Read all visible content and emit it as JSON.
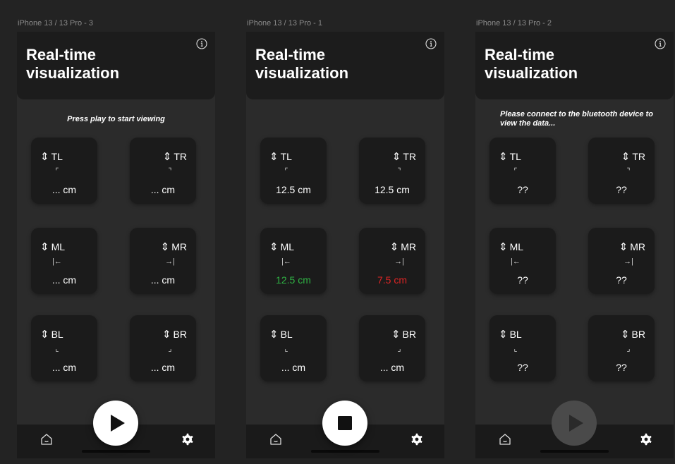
{
  "screens": [
    {
      "frame_label": "iPhone 13 / 13 Pro - 3",
      "title": "Real-time visualization",
      "message": "Press play to start viewing",
      "cards": [
        {
          "label": "TL",
          "glyph": "⌜",
          "value": "... cm"
        },
        {
          "label": "TR",
          "glyph": "⌝",
          "value": "... cm"
        },
        {
          "label": "ML",
          "glyph": "|←",
          "value": "... cm"
        },
        {
          "label": "MR",
          "glyph": "→|",
          "value": "... cm"
        },
        {
          "label": "BL",
          "glyph": "⌞",
          "value": "... cm"
        },
        {
          "label": "BR",
          "glyph": "⌟",
          "value": "... cm"
        }
      ],
      "fab_icon": "play-icon"
    },
    {
      "frame_label": "iPhone 13 / 13 Pro - 1",
      "title": "Real-time visualization",
      "message": "",
      "cards": [
        {
          "label": "TL",
          "glyph": "⌜",
          "value": "12.5 cm"
        },
        {
          "label": "TR",
          "glyph": "⌝",
          "value": "12.5 cm"
        },
        {
          "label": "ML",
          "glyph": "|←",
          "value": "12.5 cm",
          "value_color": "#2fb344"
        },
        {
          "label": "MR",
          "glyph": "→|",
          "value": "7.5 cm",
          "value_color": "#e02424"
        },
        {
          "label": "BL",
          "glyph": "⌞",
          "value": "... cm"
        },
        {
          "label": "BR",
          "glyph": "⌟",
          "value": "... cm"
        }
      ],
      "fab_icon": "stop-icon"
    },
    {
      "frame_label": "iPhone 13 / 13 Pro - 2",
      "title": "Real-time visualization",
      "message": "Please connect to the bluetooth device to view the data...",
      "cards": [
        {
          "label": "TL",
          "glyph": "⌜",
          "value": "??"
        },
        {
          "label": "TR",
          "glyph": "⌝",
          "value": "??"
        },
        {
          "label": "ML",
          "glyph": "|←",
          "value": "??"
        },
        {
          "label": "MR",
          "glyph": "→|",
          "value": "??"
        },
        {
          "label": "BL",
          "glyph": "⌞",
          "value": "??"
        },
        {
          "label": "BR",
          "glyph": "⌟",
          "value": "??"
        }
      ],
      "fab_icon": "play-icon",
      "fab_disabled": true
    }
  ],
  "arrow_glyph": "⇕",
  "icons": {
    "info": "info-icon",
    "home": "home-icon",
    "settings": "gear-icon"
  },
  "colors": {
    "background": "#232323",
    "card": "#1b1b1b",
    "good": "#2fb344",
    "bad": "#e02424"
  }
}
